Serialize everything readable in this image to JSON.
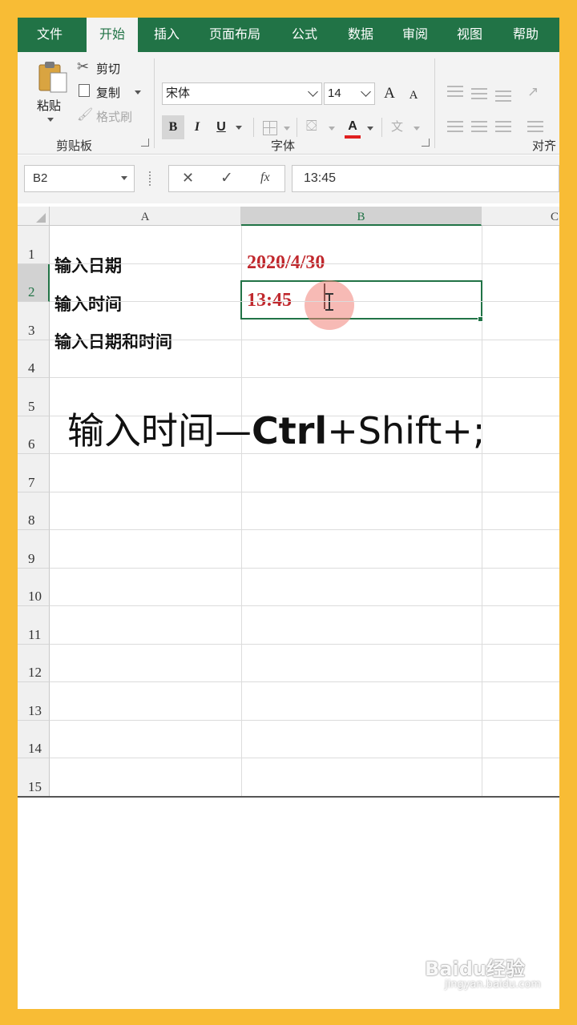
{
  "menu": {
    "tabs": [
      "文件",
      "开始",
      "插入",
      "页面布局",
      "公式",
      "数据",
      "审阅",
      "视图",
      "帮助"
    ],
    "active": "开始"
  },
  "ribbon": {
    "clipboard": {
      "paste": "粘贴",
      "cut": "剪切",
      "copy": "复制",
      "format_painter": "格式刷",
      "label": "剪贴板"
    },
    "font": {
      "name": "宋体",
      "size": "14",
      "grow": "A",
      "shrink": "A",
      "bold": "B",
      "italic": "I",
      "underline": "U",
      "font_color": "A",
      "label": "字体"
    },
    "align": {
      "label": "对齐"
    }
  },
  "formula_bar": {
    "name_box": "B2",
    "cancel": "✕",
    "enter": "✓",
    "fx": "fx",
    "content": "13:45"
  },
  "sheet": {
    "columns": [
      "A",
      "B",
      "C"
    ],
    "rows": [
      "1",
      "2",
      "3",
      "4",
      "5",
      "6",
      "7",
      "8",
      "9",
      "10",
      "11",
      "12",
      "13",
      "14",
      "15"
    ],
    "cells": {
      "A1": "输入日期",
      "B1": "2020/4/30",
      "A2": "输入时间",
      "B2": "13:45",
      "A3": "输入日期和时间"
    },
    "selected_cell": "B2"
  },
  "overlay": {
    "prefix": "输入时间—",
    "ctrl": "Ctrl",
    "suffix": "+Shift+;"
  },
  "watermark": {
    "main": "Baidu经验",
    "sub": "jingyan.baidu.com"
  },
  "colors": {
    "excel_green": "#217346",
    "border": "#f8bc35",
    "value_red": "#c0282d"
  }
}
